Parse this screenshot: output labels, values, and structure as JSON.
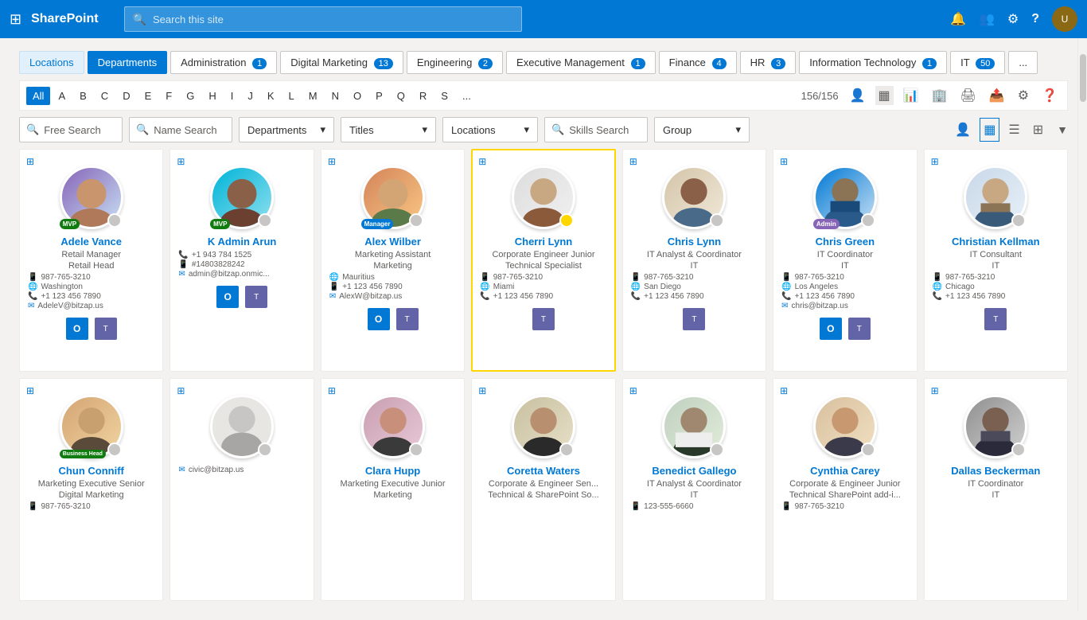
{
  "app": {
    "brand": "SharePoint",
    "search_placeholder": "Search this site"
  },
  "filter_tabs": [
    {
      "id": "locations",
      "label": "Locations",
      "badge": null,
      "active": false,
      "type": "locations"
    },
    {
      "id": "departments",
      "label": "Departments",
      "badge": null,
      "active": true,
      "type": "active"
    },
    {
      "id": "administration",
      "label": "Administration",
      "badge": "1",
      "active": false
    },
    {
      "id": "digital-marketing",
      "label": "Digital Marketing",
      "badge": "13",
      "active": false
    },
    {
      "id": "engineering",
      "label": "Engineering",
      "badge": "2",
      "active": false
    },
    {
      "id": "executive-management",
      "label": "Executive Management",
      "badge": "1",
      "active": false
    },
    {
      "id": "finance",
      "label": "Finance",
      "badge": "4",
      "active": false
    },
    {
      "id": "hr",
      "label": "HR",
      "badge": "3",
      "active": false
    },
    {
      "id": "information-technology",
      "label": "Information Technology",
      "badge": "1",
      "active": false
    },
    {
      "id": "it",
      "label": "IT",
      "badge": "50",
      "active": false
    },
    {
      "id": "more",
      "label": "...",
      "badge": null,
      "active": false
    }
  ],
  "alpha_letters": [
    "All",
    "A",
    "B",
    "C",
    "D",
    "E",
    "F",
    "G",
    "H",
    "I",
    "J",
    "K",
    "L",
    "M",
    "N",
    "O",
    "P",
    "Q",
    "R",
    "S",
    "..."
  ],
  "alpha_count": "156/156",
  "search_fields": {
    "free_search": "Free Search",
    "name_search": "Name Search",
    "departments_label": "Departments",
    "titles_label": "Titles",
    "locations_label": "Locations",
    "skills_search": "Skills Search",
    "group_label": "Group"
  },
  "persons_row1": [
    {
      "id": "adele-vance",
      "name": "Adele Vance",
      "title1": "Retail Manager",
      "title2": "Retail Head",
      "dept": "",
      "phone": "987-765-3210",
      "location": "Washington",
      "phone2": "+1 123 456 7890",
      "email": "AdeleV@bitzap.us",
      "badge": "MVP",
      "badge_type": "mvp",
      "has_outlook": true,
      "has_teams": true,
      "avatar_color": "av-purple",
      "highlighted": false
    },
    {
      "id": "k-admin-arun",
      "name": "K Admin Arun",
      "title1": "",
      "title2": "",
      "dept": "",
      "phone": "+1 943 784 1525",
      "phone_mobile": "#14803828242",
      "email": "admin@bitzap.onmic...",
      "badge": "MVP",
      "badge_type": "mvp",
      "has_outlook": true,
      "has_teams": true,
      "avatar_color": "av-teal",
      "highlighted": false
    },
    {
      "id": "alex-wilber",
      "name": "Alex Wilber",
      "title1": "Marketing Assistant",
      "title2": "Marketing",
      "dept": "",
      "phone": "",
      "location": "Mauritius",
      "phone2": "+1 123 456 7890",
      "email": "AlexW@bitzap.us",
      "badge": "Manager",
      "badge_type": "manager",
      "has_outlook": true,
      "has_teams": true,
      "avatar_color": "av-orange",
      "highlighted": false
    },
    {
      "id": "cherri-lynn",
      "name": "Cherri Lynn",
      "title1": "Corporate Engineer Junior",
      "title2": "Technical Specialist",
      "dept": "",
      "phone": "987-765-3210",
      "location": "Miami",
      "phone2": "+1 123 456 7890",
      "email": "",
      "badge": "",
      "badge_type": "",
      "has_outlook": false,
      "has_teams": true,
      "avatar_color": "av-gray",
      "highlighted": true
    },
    {
      "id": "chris-lynn",
      "name": "Chris Lynn",
      "title1": "IT Analyst & Coordinator",
      "title2": "IT",
      "dept": "",
      "phone": "987-765-3210",
      "location": "San Diego",
      "phone2": "+1 123 456 7890",
      "email": "",
      "badge": "",
      "badge_type": "",
      "has_outlook": false,
      "has_teams": true,
      "avatar_color": "av-gray",
      "highlighted": false
    },
    {
      "id": "chris-green",
      "name": "Chris Green",
      "title1": "IT Coordinator",
      "title2": "IT",
      "dept": "",
      "phone": "987-765-3210",
      "location": "Los Angeles",
      "phone2": "+1 123 456 7890",
      "email": "chris@bitzap.us",
      "badge": "Admin",
      "badge_type": "admin",
      "has_outlook": true,
      "has_teams": true,
      "avatar_color": "av-blue",
      "highlighted": false
    },
    {
      "id": "christian-kellman",
      "name": "Christian Kellman",
      "title1": "IT Consultant",
      "title2": "IT",
      "dept": "",
      "phone": "987-765-3210",
      "location": "Chicago",
      "phone2": "+1 123 456 7890",
      "email": "",
      "badge": "",
      "badge_type": "",
      "has_outlook": false,
      "has_teams": true,
      "avatar_color": "av-gray",
      "highlighted": false
    }
  ],
  "persons_row2": [
    {
      "id": "chun-conniff",
      "name": "Chun Conniff",
      "title1": "Marketing Executive Senior",
      "title2": "Digital Marketing",
      "dept": "",
      "phone": "987-765-3210",
      "location": "",
      "phone2": "",
      "email": "",
      "badge": "Business Head",
      "badge_type": "business",
      "has_outlook": false,
      "has_teams": false,
      "avatar_color": "av-orange",
      "highlighted": false
    },
    {
      "id": "civic",
      "name": "",
      "title1": "",
      "title2": "",
      "dept": "",
      "phone": "",
      "location": "",
      "phone2": "",
      "email": "civic@bitzap.us",
      "badge": "",
      "badge_type": "",
      "has_outlook": false,
      "has_teams": false,
      "avatar_color": "av-gray",
      "highlighted": false,
      "is_placeholder": true
    },
    {
      "id": "clara-hupp",
      "name": "Clara Hupp",
      "title1": "Marketing Executive Junior",
      "title2": "Marketing",
      "dept": "",
      "phone": "",
      "location": "",
      "phone2": "",
      "email": "",
      "badge": "",
      "badge_type": "",
      "has_outlook": false,
      "has_teams": false,
      "avatar_color": "av-purple",
      "highlighted": false
    },
    {
      "id": "coretta-waters",
      "name": "Coretta Waters",
      "title1": "Corporate & Engineer Sen...",
      "title2": "Technical & SharePoint So...",
      "dept": "",
      "phone": "",
      "location": "",
      "phone2": "",
      "email": "",
      "badge": "",
      "badge_type": "",
      "has_outlook": false,
      "has_teams": false,
      "avatar_color": "av-teal",
      "highlighted": false
    },
    {
      "id": "benedict-gallego",
      "name": "Benedict Gallego",
      "title1": "IT Analyst & Coordinator",
      "title2": "IT",
      "dept": "",
      "phone": "123-555-6660",
      "location": "",
      "phone2": "",
      "email": "",
      "badge": "",
      "badge_type": "",
      "has_outlook": false,
      "has_teams": false,
      "avatar_color": "av-gray",
      "highlighted": false
    },
    {
      "id": "cynthia-carey",
      "name": "Cynthia Carey",
      "title1": "Corporate & Engineer Junior",
      "title2": "Technical SharePoint add-i...",
      "dept": "",
      "phone": "987-765-3210",
      "location": "",
      "phone2": "",
      "email": "",
      "badge": "",
      "badge_type": "",
      "has_outlook": false,
      "has_teams": false,
      "avatar_color": "av-green",
      "highlighted": false
    },
    {
      "id": "dallas-beckerman",
      "name": "Dallas Beckerman",
      "title1": "IT Coordinator",
      "title2": "IT",
      "dept": "",
      "phone": "",
      "location": "",
      "phone2": "",
      "email": "",
      "badge": "",
      "badge_type": "",
      "has_outlook": false,
      "has_teams": false,
      "avatar_color": "av-gray",
      "highlighted": false
    }
  ],
  "icons": {
    "grid": "⊞",
    "search": "🔍",
    "phone": "📞",
    "mobile": "📱",
    "location": "🌐",
    "email": "✉",
    "chevron": "▾",
    "filter": "▼",
    "add_person": "👤+",
    "card_view": "▦",
    "list_view": "☰",
    "tile_view": "⊞",
    "settings": "⚙",
    "help": "?",
    "notification": "🔔",
    "people": "👥"
  }
}
